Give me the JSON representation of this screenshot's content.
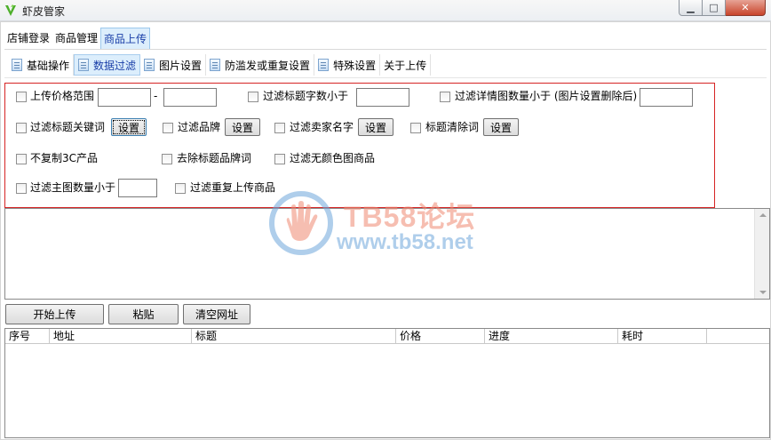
{
  "window": {
    "title": "虾皮管家",
    "controls": {
      "minimize": "▁",
      "maximize": "□",
      "close": "✕"
    }
  },
  "main_tabs": [
    {
      "label": "店铺登录",
      "active": false
    },
    {
      "label": "商品管理",
      "active": false
    },
    {
      "label": "商品上传",
      "active": true
    }
  ],
  "sub_tabs": [
    {
      "label": "基础操作",
      "active": false,
      "icon": "page-icon"
    },
    {
      "label": "数据过滤",
      "active": true,
      "icon": "page-icon"
    },
    {
      "label": "图片设置",
      "active": false,
      "icon": "page-icon"
    },
    {
      "label": "防滥发或重复设置",
      "active": false,
      "icon": "page-icon"
    },
    {
      "label": "特殊设置",
      "active": false,
      "icon": "page-icon"
    },
    {
      "label": "关于上传",
      "active": false,
      "icon": null
    }
  ],
  "filters": {
    "price_range": {
      "label": "上传价格范围",
      "min": "",
      "max": "",
      "separator": "-",
      "checked": false
    },
    "title_length": {
      "label": "过滤标题字数小于",
      "value": "",
      "checked": false
    },
    "detail_images": {
      "label": "过滤详情图数量小于 (图片设置删除后)",
      "value": "",
      "checked": false
    },
    "title_keywords": {
      "label": "过滤标题关键词",
      "button": "设置",
      "checked": false
    },
    "brand": {
      "label": "过滤品牌",
      "button": "设置",
      "checked": false
    },
    "seller_name": {
      "label": "过滤卖家名字",
      "button": "设置",
      "checked": false
    },
    "title_clear_words": {
      "label": "标题清除词",
      "button": "设置",
      "checked": false
    },
    "no_3c": {
      "label": "不复制3C产品",
      "checked": false
    },
    "remove_brand_words": {
      "label": "去除标题品牌词",
      "checked": false
    },
    "no_color_images": {
      "label": "过滤无颜色图商品",
      "checked": false
    },
    "main_images": {
      "label": "过滤主图数量小于",
      "value": "",
      "checked": false
    },
    "duplicate_upload": {
      "label": "过滤重复上传商品",
      "checked": false
    }
  },
  "url_input": {
    "value": ""
  },
  "watermark": {
    "title": "TB58论坛",
    "url": "www.tb58.net",
    "colors": {
      "title": "#f08a73",
      "url": "#6fa7db"
    }
  },
  "actions": {
    "start": "开始上传",
    "paste": "粘贴",
    "clear": "清空网址"
  },
  "table": {
    "columns": [
      "序号",
      "地址",
      "标题",
      "价格",
      "进度",
      "耗时"
    ],
    "rows": []
  },
  "colors": {
    "highlight_border": "#d62424",
    "active_tab_bg": "#dceefc",
    "active_tab_text": "#1a3fa8"
  }
}
